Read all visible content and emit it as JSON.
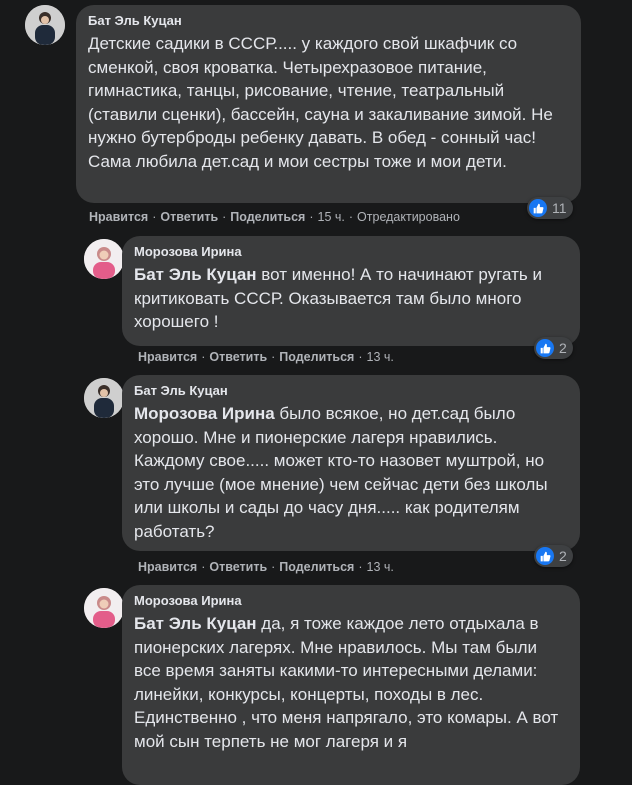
{
  "comments": [
    {
      "author": "Бат Эль Куцан",
      "text": "Детские садики в СССР..... у каждого свой шкафчик со сменкой, своя кроватка. Четырехразовое питание, гимнастика, танцы, рисование, чтение, театральный (ставили сценки), бассейн, сауна и закаливание зимой. Не нужно бутерброды ребенку давать. В обед - сонный час! Сама любила дет.сад и мои сестры тоже и мои дети.",
      "like_label": "Нравится",
      "reply_label": "Ответить",
      "share_label": "Поделиться",
      "time": "15 ч.",
      "edited": "Отредактировано",
      "reaction_count": "11"
    },
    {
      "author": "Морозова Ирина",
      "mention": "Бат Эль Куцан",
      "text": " вот именно! А то начинают ругать и критиковать СССР. Оказывается там было много хорошего !",
      "like_label": "Нравится",
      "reply_label": "Ответить",
      "share_label": "Поделиться",
      "time": "13 ч.",
      "reaction_count": "2"
    },
    {
      "author": "Бат Эль Куцан",
      "mention": "Морозова Ирина",
      "text": " было всякое, но дет.сад было хорошо. Мне и пионерские лагеря нравились. Каждому свое..... может кто-то назовет муштрой, но это лучше (мое мнение) чем сейчас дети без школы или школы и сады до часу дня..... как родителям работать?",
      "like_label": "Нравится",
      "reply_label": "Ответить",
      "share_label": "Поделиться",
      "time": "13 ч.",
      "reaction_count": "2"
    },
    {
      "author": "Морозова Ирина",
      "mention": "Бат Эль Куцан",
      "text": " да, я тоже каждое лето отдыхала в пионерских лагерях. Мне нравилось. Мы там были все время заняты какими-то интересными делами: линейки, конкурсы, концерты, походы в лес. Единственно , что меня напрягало, это комары. А вот мой сын терпеть не мог лагеря и я"
    }
  ],
  "colors": {
    "background": "#18191a",
    "bubble": "#3a3b3c",
    "text": "#e4e6eb",
    "secondary_text": "#b0b3b8",
    "like_blue": "#1877f2"
  },
  "icons": {
    "like": "thumbs-up-icon"
  }
}
